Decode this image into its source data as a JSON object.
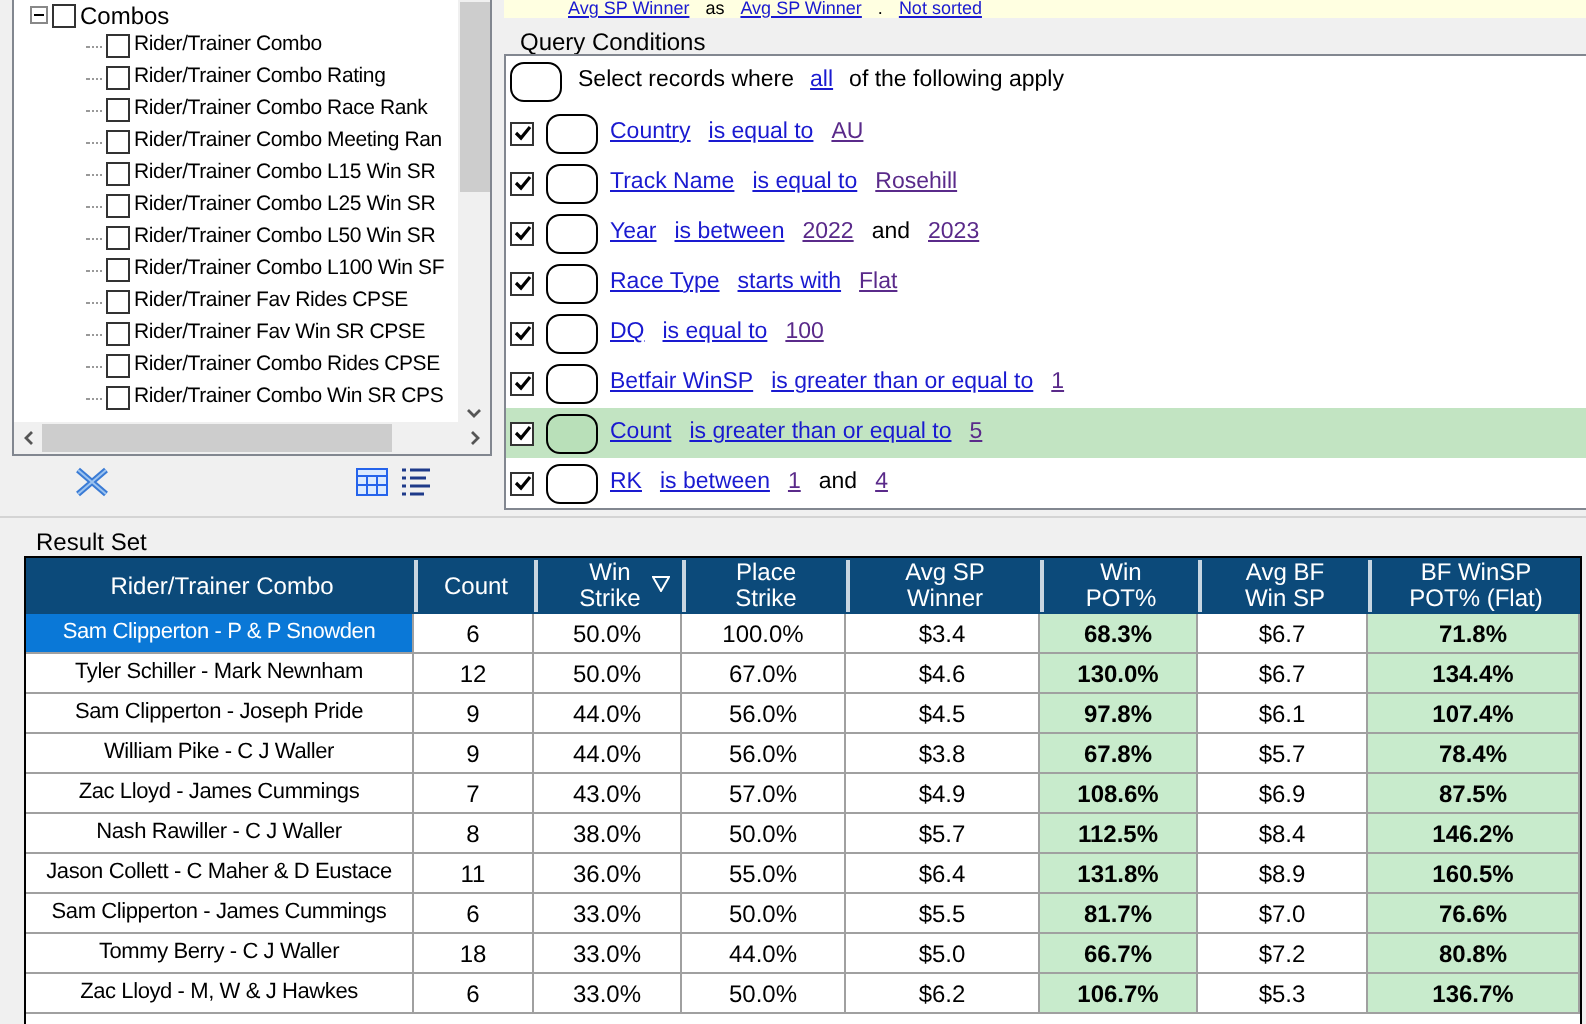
{
  "tree": {
    "label": "Combos",
    "expanded": true,
    "checked": false,
    "children": [
      {
        "label": "Rider/Trainer Combo",
        "checked": false
      },
      {
        "label": "Rider/Trainer Combo Rating",
        "checked": false
      },
      {
        "label": "Rider/Trainer Combo Race Rank",
        "checked": false
      },
      {
        "label": "Rider/Trainer Combo Meeting Ran",
        "checked": false
      },
      {
        "label": "Rider/Trainer Combo L15 Win SR",
        "checked": false
      },
      {
        "label": "Rider/Trainer Combo L25 Win SR",
        "checked": false
      },
      {
        "label": "Rider/Trainer Combo L50 Win SR",
        "checked": false
      },
      {
        "label": "Rider/Trainer Combo L100 Win SF",
        "checked": false
      },
      {
        "label": "Rider/Trainer Fav Rides CPSE",
        "checked": false
      },
      {
        "label": "Rider/Trainer Fav Win SR CPSE",
        "checked": false
      },
      {
        "label": "Rider/Trainer Combo Rides CPSE",
        "checked": false
      },
      {
        "label": "Rider/Trainer Combo Win SR CPS",
        "checked": false
      }
    ]
  },
  "sort_row": {
    "parts": [
      {
        "text": "Avg SP Winner",
        "kind": "link"
      },
      {
        "text": "as",
        "kind": "plain"
      },
      {
        "text": "Avg SP Winner",
        "kind": "link"
      },
      {
        "text": ".",
        "kind": "plain"
      },
      {
        "text": "Not sorted",
        "kind": "link"
      }
    ]
  },
  "query": {
    "title": "Query Conditions",
    "header": [
      {
        "text": "Select records where",
        "kind": "plain"
      },
      {
        "text": "all",
        "kind": "link"
      },
      {
        "text": "of the following apply",
        "kind": "plain"
      }
    ],
    "conditions": [
      {
        "checked": true,
        "selected": false,
        "parts": [
          {
            "text": "Country",
            "kind": "link"
          },
          {
            "text": "is equal to",
            "kind": "link"
          },
          {
            "text": "AU",
            "kind": "value"
          }
        ]
      },
      {
        "checked": true,
        "selected": false,
        "parts": [
          {
            "text": "Track Name",
            "kind": "link"
          },
          {
            "text": "is equal to",
            "kind": "link"
          },
          {
            "text": "Rosehill",
            "kind": "value"
          }
        ]
      },
      {
        "checked": true,
        "selected": false,
        "parts": [
          {
            "text": "Year",
            "kind": "link"
          },
          {
            "text": "is between",
            "kind": "link"
          },
          {
            "text": "2022",
            "kind": "value"
          },
          {
            "text": "and",
            "kind": "plain"
          },
          {
            "text": "2023",
            "kind": "value"
          }
        ]
      },
      {
        "checked": true,
        "selected": false,
        "parts": [
          {
            "text": "Race Type",
            "kind": "link"
          },
          {
            "text": "starts with",
            "kind": "link"
          },
          {
            "text": "Flat",
            "kind": "value"
          }
        ]
      },
      {
        "checked": true,
        "selected": false,
        "parts": [
          {
            "text": "DQ",
            "kind": "link"
          },
          {
            "text": "is equal to",
            "kind": "link"
          },
          {
            "text": "100",
            "kind": "value"
          }
        ]
      },
      {
        "checked": true,
        "selected": false,
        "parts": [
          {
            "text": "Betfair WinSP",
            "kind": "link"
          },
          {
            "text": "is greater than or equal to",
            "kind": "link"
          },
          {
            "text": "1",
            "kind": "value"
          }
        ]
      },
      {
        "checked": true,
        "selected": true,
        "parts": [
          {
            "text": "Count",
            "kind": "link"
          },
          {
            "text": "is greater than or equal to",
            "kind": "link"
          },
          {
            "text": "5",
            "kind": "value"
          }
        ]
      },
      {
        "checked": true,
        "selected": false,
        "parts": [
          {
            "text": "RK",
            "kind": "link"
          },
          {
            "text": "is between",
            "kind": "link"
          },
          {
            "text": "1",
            "kind": "value"
          },
          {
            "text": "and",
            "kind": "plain"
          },
          {
            "text": "4",
            "kind": "value"
          }
        ]
      }
    ]
  },
  "result_set": {
    "title": "Result Set",
    "columns": [
      {
        "label": "Rider/Trainer Combo",
        "highlight": false,
        "sorted": false
      },
      {
        "label": "Count",
        "highlight": false,
        "sorted": false
      },
      {
        "label": "Win\nStrike",
        "highlight": false,
        "sorted": true
      },
      {
        "label": "Place\nStrike",
        "highlight": false,
        "sorted": false
      },
      {
        "label": "Avg SP\nWinner",
        "highlight": false,
        "sorted": false
      },
      {
        "label": "Win\nPOT%",
        "highlight": true,
        "sorted": false
      },
      {
        "label": "Avg BF\nWin SP",
        "highlight": false,
        "sorted": false
      },
      {
        "label": "BF WinSP\nPOT% (Flat)",
        "highlight": true,
        "sorted": false
      }
    ],
    "rows": [
      {
        "selected": true,
        "cells": [
          "Sam Clipperton - P & P Snowden",
          "6",
          "50.0%",
          "100.0%",
          "$3.4",
          "68.3%",
          "$6.7",
          "71.8%"
        ]
      },
      {
        "selected": false,
        "cells": [
          "Tyler Schiller - Mark Newnham",
          "12",
          "50.0%",
          "67.0%",
          "$4.6",
          "130.0%",
          "$6.7",
          "134.4%"
        ]
      },
      {
        "selected": false,
        "cells": [
          "Sam Clipperton - Joseph Pride",
          "9",
          "44.0%",
          "56.0%",
          "$4.5",
          "97.8%",
          "$6.1",
          "107.4%"
        ]
      },
      {
        "selected": false,
        "cells": [
          "William Pike - C J Waller",
          "9",
          "44.0%",
          "56.0%",
          "$3.8",
          "67.8%",
          "$5.7",
          "78.4%"
        ]
      },
      {
        "selected": false,
        "cells": [
          "Zac Lloyd - James Cummings",
          "7",
          "43.0%",
          "57.0%",
          "$4.9",
          "108.6%",
          "$6.9",
          "87.5%"
        ]
      },
      {
        "selected": false,
        "cells": [
          "Nash Rawiller - C J Waller",
          "8",
          "38.0%",
          "50.0%",
          "$5.7",
          "112.5%",
          "$8.4",
          "146.2%"
        ]
      },
      {
        "selected": false,
        "cells": [
          "Jason Collett - C Maher & D Eustace",
          "11",
          "36.0%",
          "55.0%",
          "$6.4",
          "131.8%",
          "$8.9",
          "160.5%"
        ]
      },
      {
        "selected": false,
        "cells": [
          "Sam Clipperton - James Cummings",
          "6",
          "33.0%",
          "50.0%",
          "$5.5",
          "81.7%",
          "$7.0",
          "76.6%"
        ]
      },
      {
        "selected": false,
        "cells": [
          "Tommy Berry - C J Waller",
          "18",
          "33.0%",
          "44.0%",
          "$5.0",
          "66.7%",
          "$7.2",
          "80.8%"
        ]
      },
      {
        "selected": false,
        "cells": [
          "Zac Lloyd - M, W & J Hawkes",
          "6",
          "33.0%",
          "50.0%",
          "$6.2",
          "106.7%",
          "$5.3",
          "136.7%"
        ]
      }
    ]
  }
}
